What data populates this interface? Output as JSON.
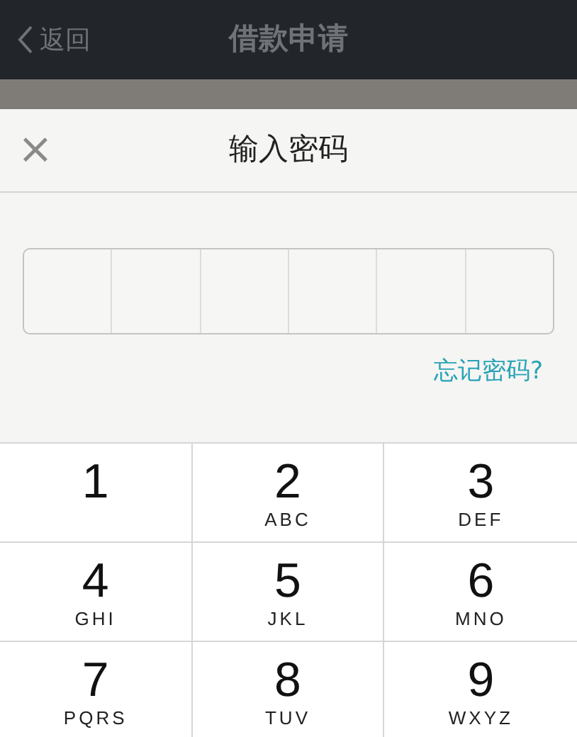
{
  "header": {
    "back": "返回",
    "title": "借款申请"
  },
  "dialog": {
    "close": "×",
    "title": "输入密码",
    "forgot_link": "忘记密码?"
  },
  "keypad": [
    {
      "digit": "1"
    },
    {
      "digit": "2",
      "letters": "ABC"
    },
    {
      "digit": "3",
      "letters": "DEF"
    },
    {
      "digit": "4",
      "letters": "GHI"
    },
    {
      "digit": "5",
      "letters": "JKL"
    },
    {
      "digit": "6",
      "letters": "MNO"
    },
    {
      "digit": "7",
      "letters": "PQRS"
    },
    {
      "digit": "8",
      "letters": "TUV"
    },
    {
      "digit": "9",
      "letters": "WXYZ"
    }
  ]
}
